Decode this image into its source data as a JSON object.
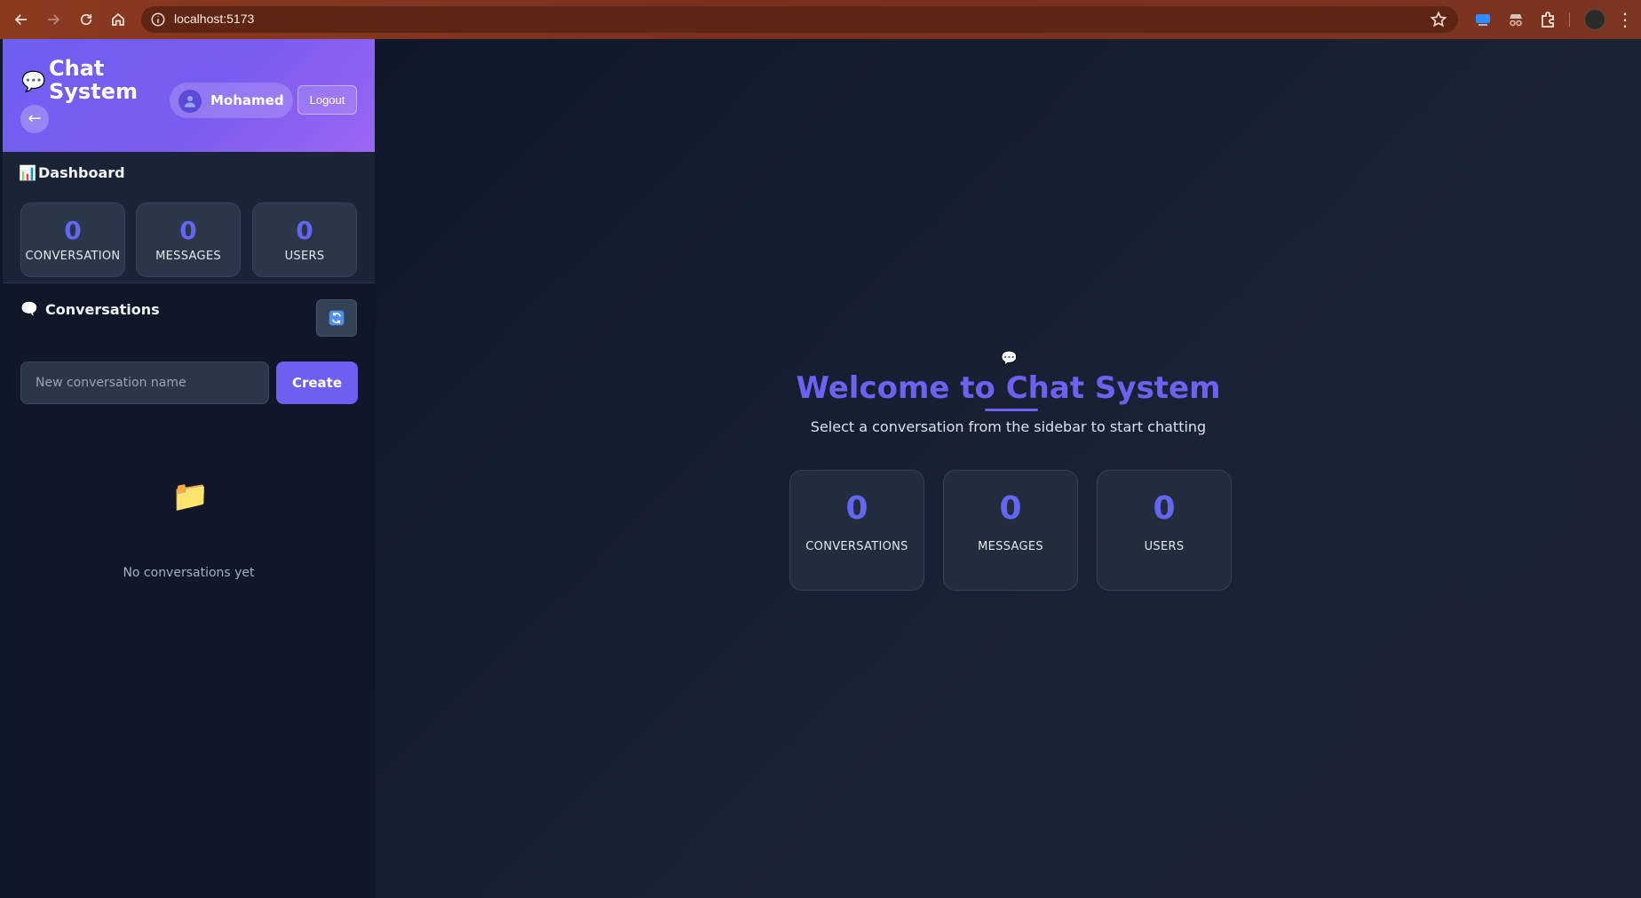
{
  "browser": {
    "url": "localhost:5173"
  },
  "sidebar": {
    "brand_title": "Chat System",
    "brand_icon": "speech-bubble-icon",
    "back_label": "←",
    "user_name": "Mohamed",
    "logout_label": "Logout",
    "dashboard": {
      "title": "Dashboard",
      "stats": [
        {
          "value": "0",
          "label": "CONVERSATION"
        },
        {
          "value": "0",
          "label": "MESSAGES"
        },
        {
          "value": "0",
          "label": "USERS"
        }
      ]
    },
    "conversations": {
      "title": "Conversations",
      "input_placeholder": "New conversation name",
      "input_value": "",
      "create_label": "Create",
      "empty_text": "No conversations yet"
    }
  },
  "main": {
    "welcome_title": "Welcome to Chat System",
    "welcome_subtitle": "Select a conversation from the sidebar to start chatting",
    "stats": [
      {
        "value": "0",
        "label": "CONVERSATIONS"
      },
      {
        "value": "0",
        "label": "MESSAGES"
      },
      {
        "value": "0",
        "label": "USERS"
      }
    ]
  },
  "colors": {
    "accent": "#6366f1",
    "header_gradient_start": "#6d5ff0",
    "header_gradient_end": "#9a66f2",
    "chrome": "#7a2f1c"
  }
}
